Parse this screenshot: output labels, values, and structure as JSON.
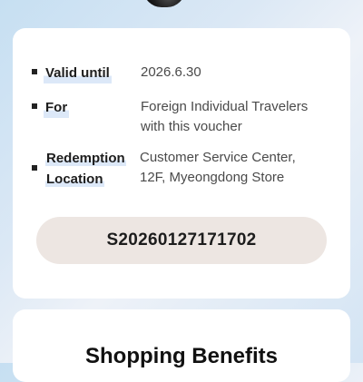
{
  "voucher": {
    "valid_until_label": "Valid until",
    "valid_until_value": "2026.6.30",
    "for_label": "For",
    "for_value_line1": "Foreign Individual Travelers",
    "for_value_line2": "with this voucher",
    "location_label_line1": "Redemption",
    "location_label_line2": "Location",
    "location_value_line1": "Customer Service Center,",
    "location_value_line2": "12F, Myeongdong Store",
    "code": "S20260127171702"
  },
  "benefits": {
    "title": "Shopping Benefits"
  },
  "colors": {
    "label_highlight": "#dce8f8",
    "code_pill_bg": "#ede6e2"
  }
}
